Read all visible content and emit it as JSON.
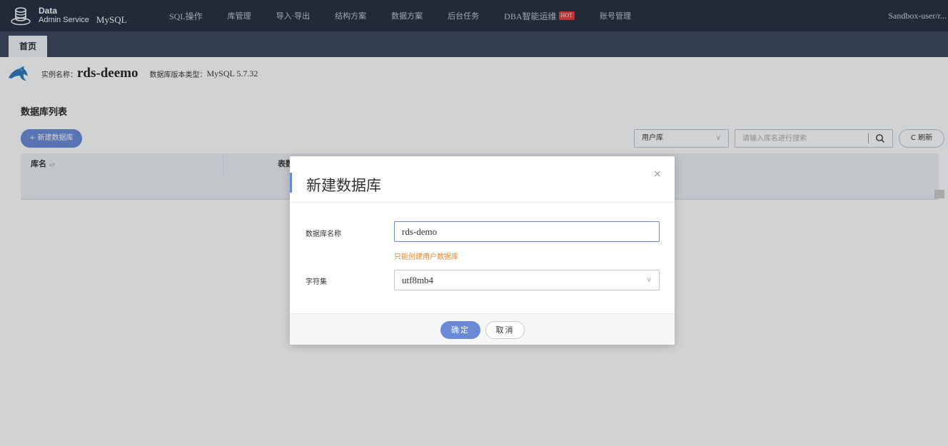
{
  "brand": {
    "line1": "Data",
    "line2": "Admin Service",
    "db": "MySQL"
  },
  "nav": {
    "items": [
      {
        "label": "SQL操作"
      },
      {
        "label": "库管理"
      },
      {
        "label": "导入·导出"
      },
      {
        "label": "结构方案"
      },
      {
        "label": "数据方案"
      },
      {
        "label": "后台任务"
      },
      {
        "label": "DBA智能运维",
        "badge": "HOT"
      },
      {
        "label": "账号管理"
      }
    ],
    "user": "Sandbox-user/r..."
  },
  "tabs": {
    "home": "首页"
  },
  "instance": {
    "name_label": "实例名称：",
    "name": "rds-deemo",
    "version_label": "数据库版本类型：",
    "version": "MySQL 5.7.32"
  },
  "dblist": {
    "title": "数据库列表",
    "new_button": "+ 新建数据库",
    "filter_value": "用户库",
    "search_placeholder": "请输入库名进行搜索",
    "refresh": "C 刷新",
    "columns": [
      "库名",
      "表数"
    ]
  },
  "modal": {
    "title": "新建数据库",
    "close": "×",
    "name_label": "数据库名称",
    "name_value": "rds-demo",
    "hint": "只能创建用户数据库",
    "charset_label": "字符集",
    "charset_value": "utf8mb4",
    "ok": "确定",
    "cancel": "取消"
  },
  "colors": {
    "nav_bg": "#252d3c",
    "tab_bg": "#3b475b",
    "accent": "#6b8ad6",
    "hot": "#e23c39",
    "hint": "#e0892f"
  }
}
